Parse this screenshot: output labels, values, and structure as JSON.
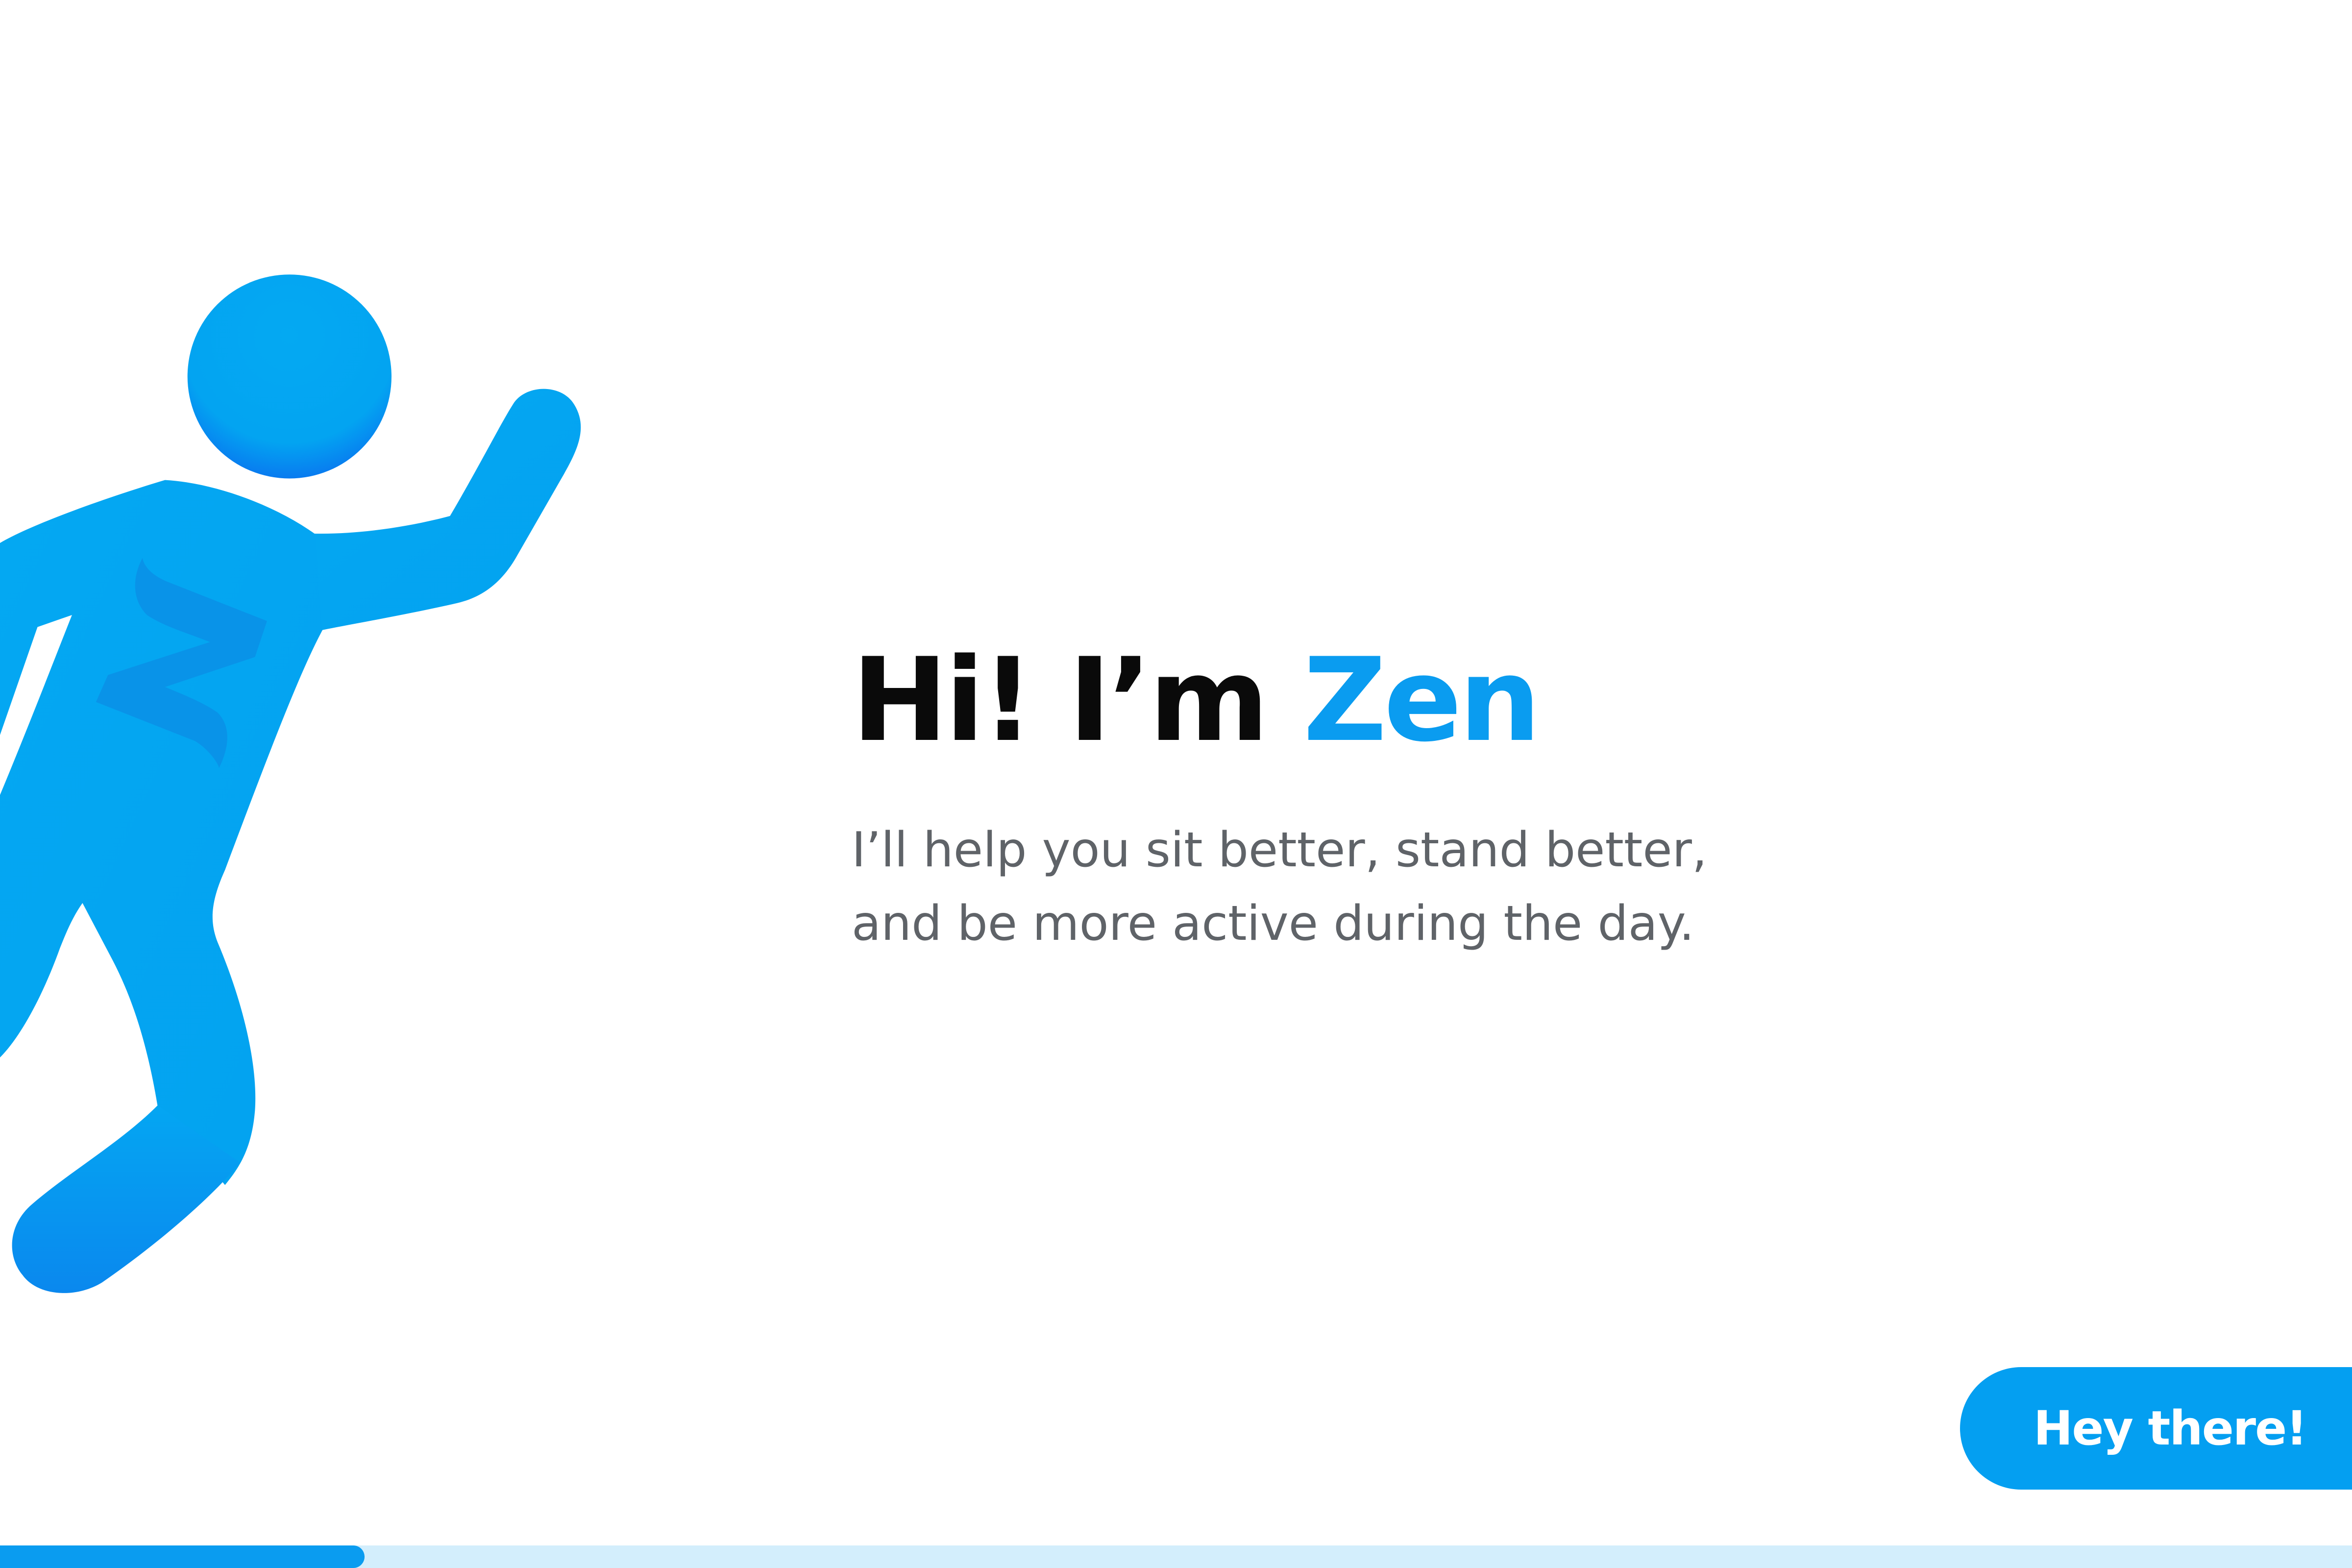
{
  "headline": {
    "prefix": "Hi! I’m ",
    "name": "Zen"
  },
  "subtitle": {
    "line1": "I’ll help you sit better, stand better,",
    "line2": "and be more active during the day."
  },
  "cta": {
    "label": "Hey there!"
  },
  "progress": {
    "fraction": 0.155
  },
  "mascot": {
    "icon": "zen-mascot-figure",
    "chest_letter_icon": "z-letter-icon"
  },
  "colors": {
    "brand": "#0a9cf0",
    "progress_track": "#d3eefc",
    "headline_text": "#0a0a0a",
    "body_text": "#5f6368"
  }
}
